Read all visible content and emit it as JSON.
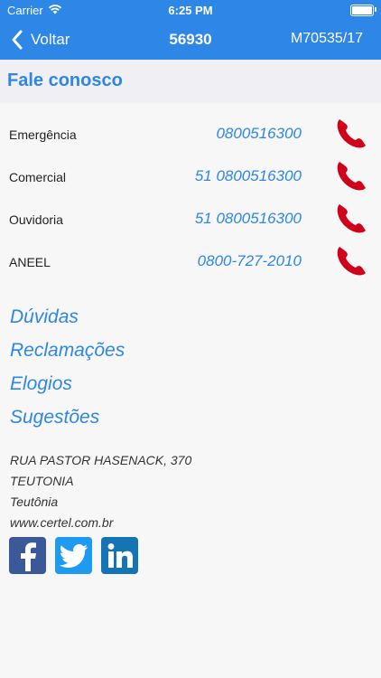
{
  "status_bar": {
    "carrier": "Carrier",
    "time": "6:25 PM"
  },
  "nav": {
    "back_label": "Voltar",
    "title": "56930",
    "right_label": "M70535/17"
  },
  "section": {
    "title": "Fale conosco"
  },
  "contacts": [
    {
      "label": "Emergência",
      "number": "0800516300"
    },
    {
      "label": "Comercial",
      "number": "51 0800516300"
    },
    {
      "label": "Ouvidoria",
      "number": "51 0800516300"
    },
    {
      "label": "ANEEL",
      "number": "0800-727-2010"
    }
  ],
  "links": [
    "Dúvidas",
    "Reclamações",
    "Elogios",
    "Sugestões"
  ],
  "address": {
    "street": "RUA PASTOR HASENACK, 370",
    "city_upper": "TEUTONIA",
    "city": "Teutônia",
    "website": "www.certel.com.br"
  },
  "social": [
    "facebook-icon",
    "twitter-icon",
    "linkedin-icon"
  ],
  "colors": {
    "accent": "#2e86e6",
    "phone_icon": "#d0021b",
    "facebook": "#3b5998",
    "twitter": "#1d9bf0",
    "linkedin": "#1575b4"
  }
}
